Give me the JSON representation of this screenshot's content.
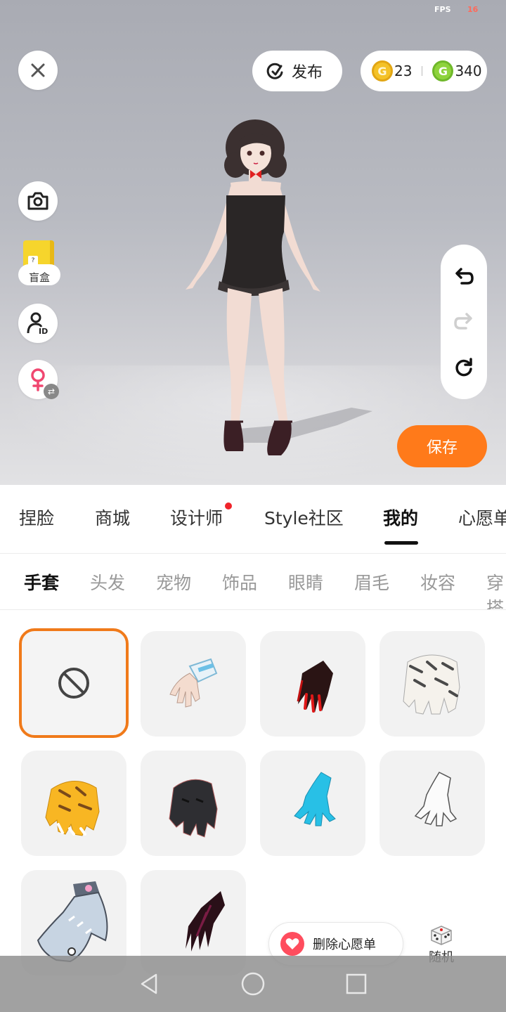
{
  "status": {
    "fps_label": "FPS",
    "fps_value": "16"
  },
  "top_bar": {
    "publish_label": "发布",
    "currency": {
      "gold_value": "23",
      "green_value": "340",
      "gold_symbol": "G",
      "green_symbol": "G"
    }
  },
  "side_tools": {
    "blindbox_label": "盲盒",
    "blindbox_symbol": "?",
    "swap_symbol": "⇄"
  },
  "save_label": "保存",
  "main_tabs": [
    {
      "label": "捏脸",
      "active": false,
      "dot": false
    },
    {
      "label": "商城",
      "active": false,
      "dot": false
    },
    {
      "label": "设计师",
      "active": false,
      "dot": true
    },
    {
      "label": "Style社区",
      "active": false,
      "dot": false
    },
    {
      "label": "我的",
      "active": true,
      "dot": false
    },
    {
      "label": "心愿单",
      "active": false,
      "dot": false
    }
  ],
  "sub_tabs": [
    {
      "label": "手套",
      "active": true
    },
    {
      "label": "头发",
      "active": false
    },
    {
      "label": "宠物",
      "active": false
    },
    {
      "label": "饰品",
      "active": false
    },
    {
      "label": "眼睛",
      "active": false
    },
    {
      "label": "眉毛",
      "active": false
    },
    {
      "label": "妆容",
      "active": false
    },
    {
      "label": "穿搭",
      "active": false
    }
  ],
  "grid_items": [
    {
      "icon": "none-icon",
      "selected": true
    },
    {
      "icon": "white-blue-glove-icon",
      "selected": false
    },
    {
      "icon": "black-red-claw-glove-icon",
      "selected": false
    },
    {
      "icon": "white-tiger-glove-icon",
      "selected": false
    },
    {
      "icon": "yellow-tiger-glove-icon",
      "selected": false
    },
    {
      "icon": "black-glove-icon",
      "selected": false
    },
    {
      "icon": "cyan-glove-icon",
      "selected": false
    },
    {
      "icon": "white-lace-glove-icon",
      "selected": false
    },
    {
      "icon": "shark-glove-icon",
      "selected": false
    },
    {
      "icon": "dark-claw-glove-icon",
      "selected": false
    }
  ],
  "wishlist_label": "删除心愿单",
  "random_label": "随机",
  "colors": {
    "accent": "#ff7a1a",
    "selected_border": "#f07a1a",
    "notify_dot": "#f0242a"
  }
}
